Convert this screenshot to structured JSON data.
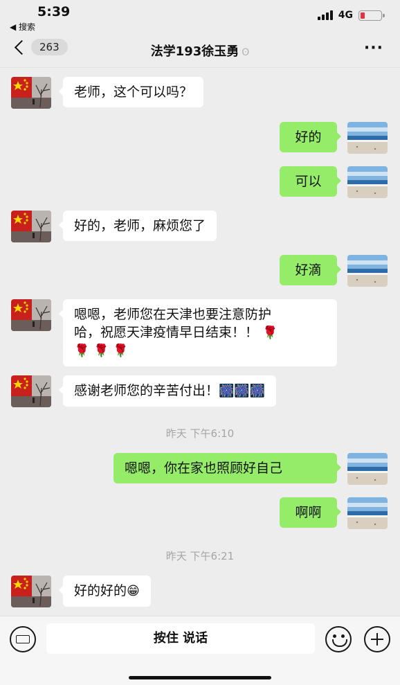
{
  "status_bar": {
    "time": "5:39",
    "back_app": "◀ 搜索",
    "network": "4G"
  },
  "nav": {
    "unread_count": "263",
    "title": "法学193徐玉勇",
    "more_label": "···"
  },
  "messages": [
    {
      "side": "left",
      "text": "老师，这个可以吗？"
    },
    {
      "side": "right",
      "text": "好的"
    },
    {
      "side": "right",
      "text": "可以"
    },
    {
      "side": "left",
      "text": "好的，老师，麻烦您了"
    },
    {
      "side": "right",
      "text": "好滴"
    },
    {
      "side": "left",
      "line1": "嗯嗯，老师您在天津也要注意防护",
      "line2": "哈，祝愿天津疫情早日结束！！",
      "emoji_rose": "🌹",
      "emoji_roses_line3": "🌹 🌹 🌹"
    },
    {
      "side": "left",
      "text": "感谢老师您的辛苦付出！",
      "emoji": "🎆🎆🎆"
    },
    {
      "side": "right",
      "text": "嗯嗯，你在家也照顾好自己"
    },
    {
      "side": "right",
      "text": "啊啊"
    },
    {
      "side": "left",
      "text": "好的好的",
      "emoji": "😁"
    }
  ],
  "timestamps": [
    "昨天 下午6:10",
    "昨天 下午6:21"
  ],
  "input_bar": {
    "hold_to_talk": "按住 说话"
  }
}
